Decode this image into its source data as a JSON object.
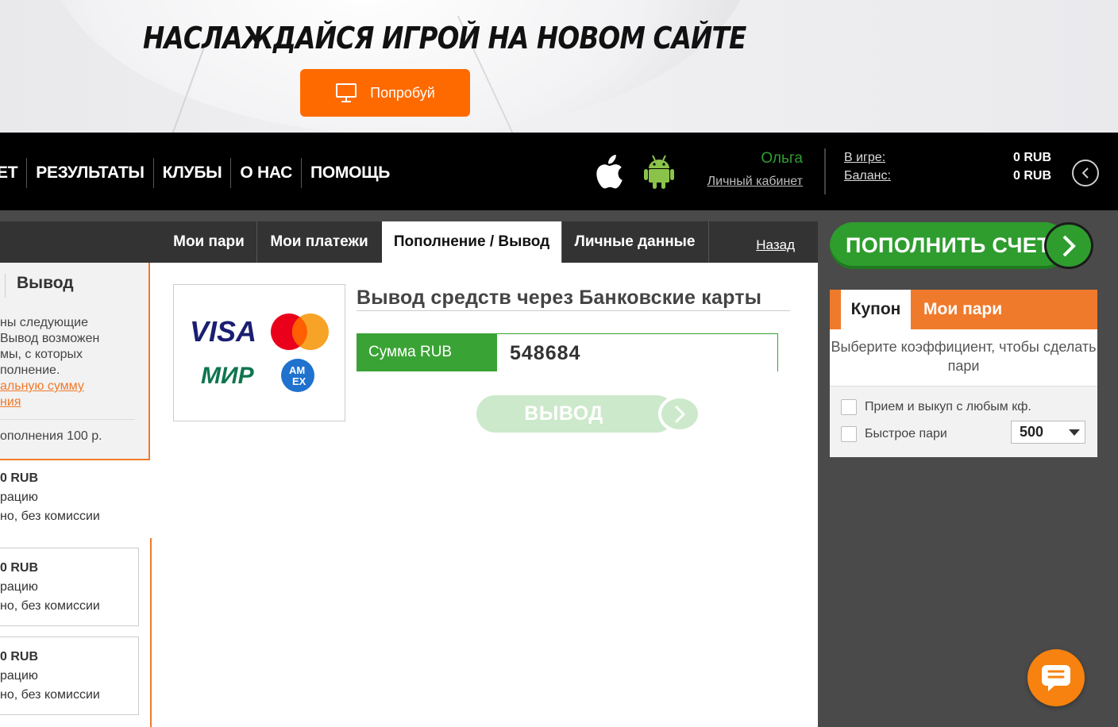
{
  "banner": {
    "title": "НАСЛАЖДАЙСЯ ИГРОЙ НА НОВОМ САЙТЕ",
    "try_label": "Попробуй",
    "icon": "monitor-icon"
  },
  "nav": {
    "items": [
      "ЕТ",
      "РЕЗУЛЬТАТЫ",
      "КЛУБЫ",
      "О НАС",
      "ПОМОЩЬ"
    ],
    "user_name": "Ольга",
    "cabinet_link": "Личный кабинет",
    "in_game_label": "В игре:",
    "in_game_value": "0 RUB",
    "balance_label": "Баланс:",
    "balance_value": "0 RUB"
  },
  "tabs": [
    {
      "label": "Мои пари"
    },
    {
      "label": "Мои платежи"
    },
    {
      "label": "Пополнение / Вывод"
    },
    {
      "label": "Личные данные"
    }
  ],
  "back_link": "Назад",
  "left": {
    "tab": "Вывод",
    "text_lines": [
      "ны следующие",
      "Вывод возможен",
      "мы, с которых",
      "полнение."
    ],
    "link_lines": [
      "альную сумму",
      "ния"
    ],
    "min_text": "ополнения 100 р.",
    "methods": [
      {
        "amount": "0 RUB",
        "line1": "рацию",
        "line2": "но, без комиссии"
      },
      {
        "amount": "0 RUB",
        "line1": "рацию",
        "line2": "но, без комиссии"
      },
      {
        "amount": "0 RUB",
        "line1": "рацию",
        "line2": "но, без комиссии"
      }
    ]
  },
  "withdraw": {
    "title": "Вывод средств через Банковские карты",
    "amount_label": "Сумма RUB",
    "amount_value": "548684",
    "button_label": "ВЫВОД",
    "cards": {
      "visa": "VISA",
      "mir": "МИР",
      "amex_top": "AM",
      "amex_bottom": "EX"
    }
  },
  "deposit_button": "ПОПОЛНИТЬ СЧЕТ",
  "coupon": {
    "tab_active": "Купон",
    "tab_other": "Мои пари",
    "message": "Выберите коэффициент, чтобы сделать пари",
    "option1": "Прием и выкуп с любым кф.",
    "option2": "Быстрое пари",
    "quick_amount": "500"
  },
  "colors": {
    "accent_orange": "#ff6a00",
    "green": "#2e9d2e",
    "nav_bg": "#000000"
  }
}
